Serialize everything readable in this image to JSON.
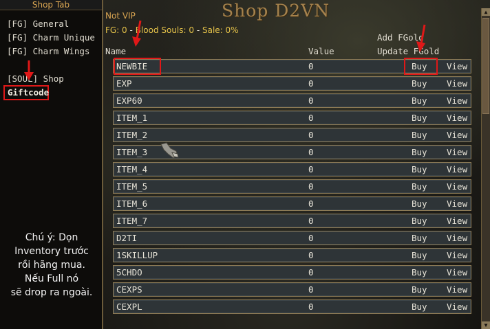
{
  "left_panel": {
    "header": "Shop Tab",
    "tabs": [
      {
        "label": "[FG] General"
      },
      {
        "label": "[FG] Charm Unique"
      },
      {
        "label": "[FG] Charm Wings"
      },
      {
        "label": "[SOUL] Shop"
      },
      {
        "label": "Giftcode"
      }
    ],
    "note_lines": [
      "Chú ý: Dọn",
      "Inventory trước",
      "rồi hãng mua.",
      "Nếu Full nó",
      "sẽ drop ra ngoài."
    ]
  },
  "header": {
    "title": "Shop D2VN",
    "vip_status": "Not VIP",
    "fg_label": "FG: 0",
    "blood_souls_label": "Blood Souls: 0",
    "sale_label": "Sale: 0%",
    "add_fgold": "Add FGold",
    "update_fgold": "Update FGold"
  },
  "table": {
    "columns": [
      "Name",
      "Value"
    ],
    "buy_label": "Buy",
    "view_label": "View",
    "rows": [
      {
        "name": "NEWBIE",
        "value": "0"
      },
      {
        "name": "EXP",
        "value": "0"
      },
      {
        "name": "EXP60",
        "value": "0"
      },
      {
        "name": "ITEM_1",
        "value": "0"
      },
      {
        "name": "ITEM_2",
        "value": "0"
      },
      {
        "name": "ITEM_3",
        "value": "0"
      },
      {
        "name": "ITEM_4",
        "value": "0"
      },
      {
        "name": "ITEM_5",
        "value": "0"
      },
      {
        "name": "ITEM_6",
        "value": "0"
      },
      {
        "name": "ITEM_7",
        "value": "0"
      },
      {
        "name": "D2TI",
        "value": "0"
      },
      {
        "name": "1SKILLUP",
        "value": "0"
      },
      {
        "name": "5CHDO",
        "value": "0"
      },
      {
        "name": "CEXPS",
        "value": "0"
      },
      {
        "name": "CEXPL",
        "value": "0"
      }
    ]
  },
  "colors": {
    "highlight": "#e01818",
    "title": "#a5824d",
    "gold": "#d9a552"
  }
}
